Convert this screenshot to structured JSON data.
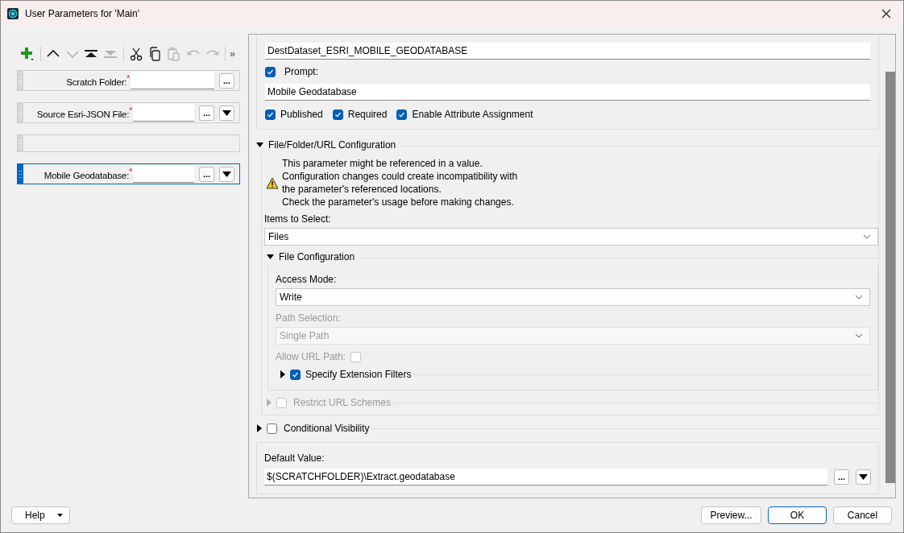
{
  "window": {
    "title": "User Parameters for 'Main'"
  },
  "toolbar": {
    "items": [
      {
        "kind": "add",
        "disabled": false
      },
      {
        "kind": "sep"
      },
      {
        "kind": "up",
        "disabled": false
      },
      {
        "kind": "down",
        "disabled": true
      },
      {
        "kind": "top",
        "disabled": false
      },
      {
        "kind": "bottom",
        "disabled": true
      },
      {
        "kind": "sep"
      },
      {
        "kind": "cut",
        "disabled": false
      },
      {
        "kind": "copy",
        "disabled": false
      },
      {
        "kind": "paste",
        "disabled": true
      },
      {
        "kind": "undo",
        "disabled": true
      },
      {
        "kind": "redo",
        "disabled": true
      },
      {
        "kind": "sep"
      }
    ],
    "overflow": "»"
  },
  "parameters": [
    {
      "kind": "param",
      "label": "Scratch Folder:",
      "required_mark": "*",
      "browse": "...",
      "dropdown": false,
      "selected": false
    },
    {
      "kind": "param",
      "label": "Source Esri-JSON File:",
      "required_mark": "*",
      "browse": "...",
      "dropdown": true,
      "selected": false
    },
    {
      "kind": "blank",
      "selected": false
    },
    {
      "kind": "param",
      "label": "Mobile Geodatabase:",
      "required_mark": "*",
      "browse": "...",
      "dropdown": true,
      "selected": true
    }
  ],
  "details": {
    "name_value": "DestDataset_ESRI_MOBILE_GEODATABASE",
    "prompt": {
      "label": "Prompt:",
      "checked": true
    },
    "prompt_value": "Mobile Geodatabase",
    "flags": [
      {
        "label": "Published",
        "checked": true
      },
      {
        "label": "Required",
        "checked": true
      },
      {
        "label": "Enable Attribute Assignment",
        "checked": true
      }
    ],
    "file_section": {
      "title": "File/Folder/URL Configuration",
      "expanded": true,
      "warning": [
        "This parameter might be referenced in a value.",
        "Configuration changes could create incompatibility with",
        "the parameter's referenced locations.",
        "Check the parameter's usage before making changes."
      ],
      "items_label": "Items to Select:",
      "items_value": "Files",
      "file_config": {
        "title": "File Configuration",
        "expanded": true,
        "access_label": "Access Mode:",
        "access_value": "Write",
        "path_label": "Path Selection:",
        "path_value": "Single Path",
        "path_disabled": true,
        "allow_url": {
          "label": "Allow URL Path:",
          "checked": false,
          "disabled": true
        },
        "ext_filters": {
          "label": "Specify Extension Filters",
          "checked": true,
          "expanded": false
        }
      },
      "restrict": {
        "label": "Restrict URL Schemes",
        "checked": false,
        "expanded": false,
        "disabled": true
      }
    },
    "conditional": {
      "label": "Conditional Visibility",
      "checked": false,
      "expanded": false
    },
    "default": {
      "label": "Default Value:",
      "value": "$(SCRATCHFOLDER)\\Extract.geodatabase",
      "browse": "..."
    }
  },
  "buttons": {
    "help": "Help",
    "preview": "Preview...",
    "ok": "OK",
    "cancel": "Cancel"
  }
}
